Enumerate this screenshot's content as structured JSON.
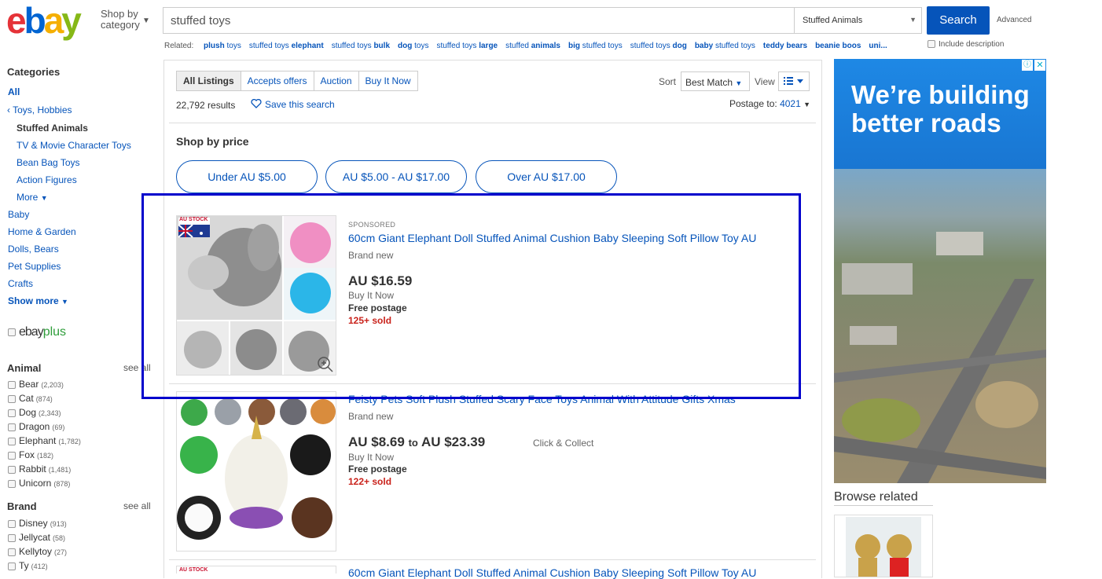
{
  "header": {
    "logo": [
      "e",
      "b",
      "a",
      "y"
    ],
    "shop_by_line1": "Shop by",
    "shop_by_line2": "category",
    "search_value": "stuffed toys",
    "category_select": "Stuffed Animals",
    "search_button": "Search",
    "advanced": "Advanced",
    "include_description": "Include description",
    "related_label": "Related:",
    "related": [
      {
        "pre": "",
        "bold": "plush",
        "post": " toys"
      },
      {
        "pre": "stuffed toys ",
        "bold": "elephant",
        "post": ""
      },
      {
        "pre": "stuffed toys ",
        "bold": "bulk",
        "post": ""
      },
      {
        "pre": "",
        "bold": "dog",
        "post": " toys"
      },
      {
        "pre": "stuffed toys ",
        "bold": "large",
        "post": ""
      },
      {
        "pre": "stuffed ",
        "bold": "animals",
        "post": ""
      },
      {
        "pre": "",
        "bold": "big",
        "post": " stuffed toys"
      },
      {
        "pre": "stuffed toys ",
        "bold": "dog",
        "post": ""
      },
      {
        "pre": "",
        "bold": "baby",
        "post": " stuffed toys"
      },
      {
        "pre": "",
        "bold": "teddy bears",
        "post": ""
      },
      {
        "pre": "",
        "bold": "beanie boos",
        "post": ""
      },
      {
        "pre": "",
        "bold": "uni...",
        "post": ""
      }
    ]
  },
  "sidebar": {
    "categories_heading": "Categories",
    "all": "All",
    "parent": "Toys, Hobbies",
    "current": "Stuffed Animals",
    "subcategories": [
      "TV & Movie Character Toys",
      "Bean Bag Toys",
      "Action Figures"
    ],
    "more": "More",
    "other_categories": [
      "Baby",
      "Home & Garden",
      "Dolls, Bears",
      "Pet Supplies",
      "Crafts"
    ],
    "show_more": "Show more",
    "ebayplus_word": "ebay",
    "ebayplus_plus": "plus",
    "animal_heading": "Animal",
    "brand_heading": "Brand",
    "see_all": "see all",
    "animals": [
      {
        "label": "Bear",
        "count": "(2,203)"
      },
      {
        "label": "Cat",
        "count": "(874)"
      },
      {
        "label": "Dog",
        "count": "(2,343)"
      },
      {
        "label": "Dragon",
        "count": "(69)"
      },
      {
        "label": "Elephant",
        "count": "(1,782)"
      },
      {
        "label": "Fox",
        "count": "(182)"
      },
      {
        "label": "Rabbit",
        "count": "(1,481)"
      },
      {
        "label": "Unicorn",
        "count": "(878)"
      }
    ],
    "brands": [
      {
        "label": "Disney",
        "count": "(913)"
      },
      {
        "label": "Jellycat",
        "count": "(58)"
      },
      {
        "label": "Kellytoy",
        "count": "(27)"
      },
      {
        "label": "Ty",
        "count": "(412)"
      }
    ]
  },
  "toolbar": {
    "tabs": [
      "All Listings",
      "Accepts offers",
      "Auction",
      "Buy It Now"
    ],
    "results": "22,792 results",
    "save_search": "Save this search",
    "sort_label": "Sort",
    "sort_value": "Best Match",
    "view_label": "View",
    "postage_to_label": "Postage to:",
    "postage_to_value": "4021"
  },
  "shop_by_price": {
    "heading": "Shop by price",
    "ranges": [
      "Under AU $5.00",
      "AU $5.00 - AU $17.00",
      "Over AU $17.00"
    ]
  },
  "listings": [
    {
      "sponsored": "SPONSORED",
      "badge": "AU STOCK",
      "title": "60cm Giant Elephant Doll Stuffed Animal Cushion Baby Sleeping Soft Pillow Toy AU",
      "condition": "Brand new",
      "price": "AU $16.59",
      "format": "Buy It Now",
      "postage": "Free postage",
      "sold": "125+ sold"
    },
    {
      "title": "Feisty Pets Soft Plush Stuffed Scary Face Toys Animal With Attitude Gifts Xmas",
      "condition": "Brand new",
      "price_low": "AU $8.69",
      "price_to": "to",
      "price_high": "AU $23.39",
      "click_collect": "Click & Collect",
      "format": "Buy It Now",
      "postage": "Free postage",
      "sold": "122+ sold"
    },
    {
      "badge": "AU STOCK",
      "title": "60cm Giant Elephant Doll Stuffed Animal Cushion Baby Sleeping Soft Pillow Toy AU"
    }
  ],
  "right": {
    "ad_line1": "We’re building",
    "ad_line2": "better roads",
    "browse_related": "Browse related"
  },
  "colors": {
    "link": "#0654ba",
    "sold": "#c9221b",
    "highlight_box": "#0000cc",
    "search_button": "#0654ba"
  }
}
